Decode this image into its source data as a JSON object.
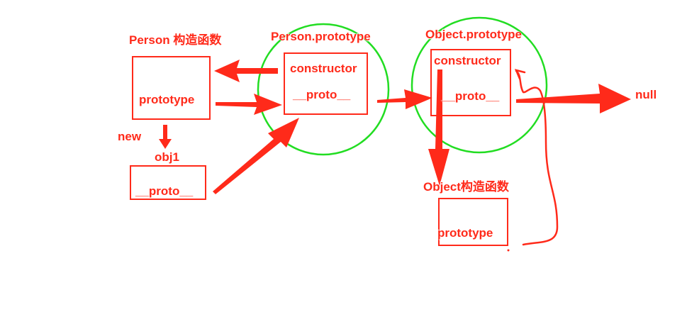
{
  "colors": {
    "arrow": "#ff2a1a",
    "circle": "#22dd22",
    "text": "#ff2a1a",
    "background": "#ffffff"
  },
  "labels": {
    "person_constructor": "Person 构造函数",
    "person_prototype_title": "Person.prototype",
    "object_prototype_title": "Object.prototype",
    "object_constructor": "Object构造函数",
    "new": "new",
    "obj1": "obj1",
    "null": "null"
  },
  "boxes": {
    "person_fn_field": "prototype",
    "obj1_field": "__proto__",
    "person_proto_constructor": "constructor",
    "person_proto_proto": "__proto__",
    "object_proto_constructor": "constructor",
    "object_proto_proto": "__proto__",
    "object_fn_field": "prototype"
  }
}
